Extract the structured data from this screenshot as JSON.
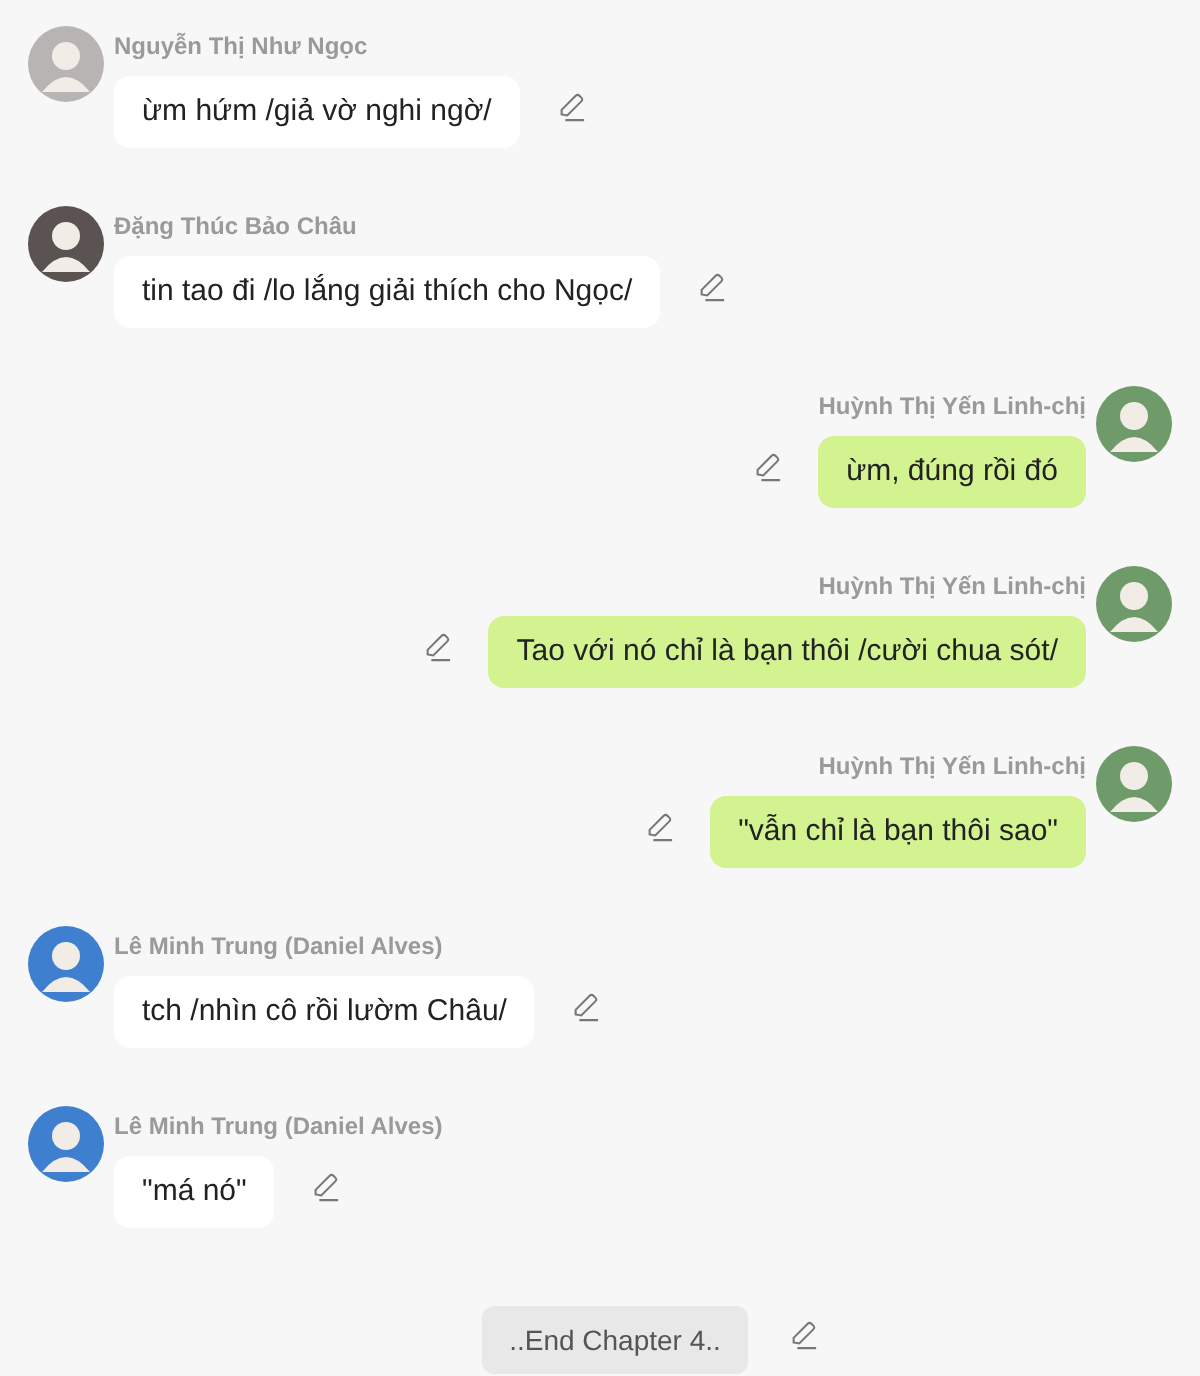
{
  "messages": [
    {
      "kind": "received",
      "sender": "Nguyễn Thị Như Ngọc",
      "text": "ừm hứm /giả vờ nghi ngờ/",
      "color": "#b9b4b4"
    },
    {
      "kind": "received",
      "sender": "Đặng Thúc Bảo Châu",
      "text": "tin tao đi /lo lắng giải thích cho Ngọc/",
      "color": "#5b5352"
    },
    {
      "kind": "sent",
      "sender": "Huỳnh Thị Yến Linh-chị",
      "text": "ừm, đúng rồi đó",
      "color": "#6f9a6a"
    },
    {
      "kind": "sent",
      "sender": "Huỳnh Thị Yến Linh-chị",
      "text": "Tao với nó chỉ là bạn thôi /cười chua sót/",
      "color": "#6f9a6a"
    },
    {
      "kind": "sent",
      "sender": "Huỳnh Thị Yến Linh-chị",
      "text": "\"vẫn chỉ là bạn thôi sao\"",
      "color": "#6f9a6a"
    },
    {
      "kind": "received",
      "sender": "Lê Minh Trung (Daniel Alves)",
      "text": "tch /nhìn cô rồi lườm Châu/",
      "color": "#3f7fd0"
    },
    {
      "kind": "received",
      "sender": "Lê Minh Trung (Daniel Alves)",
      "text": "\"má nó\"",
      "color": "#3f7fd0"
    }
  ],
  "end_note": "..End Chapter 4.."
}
